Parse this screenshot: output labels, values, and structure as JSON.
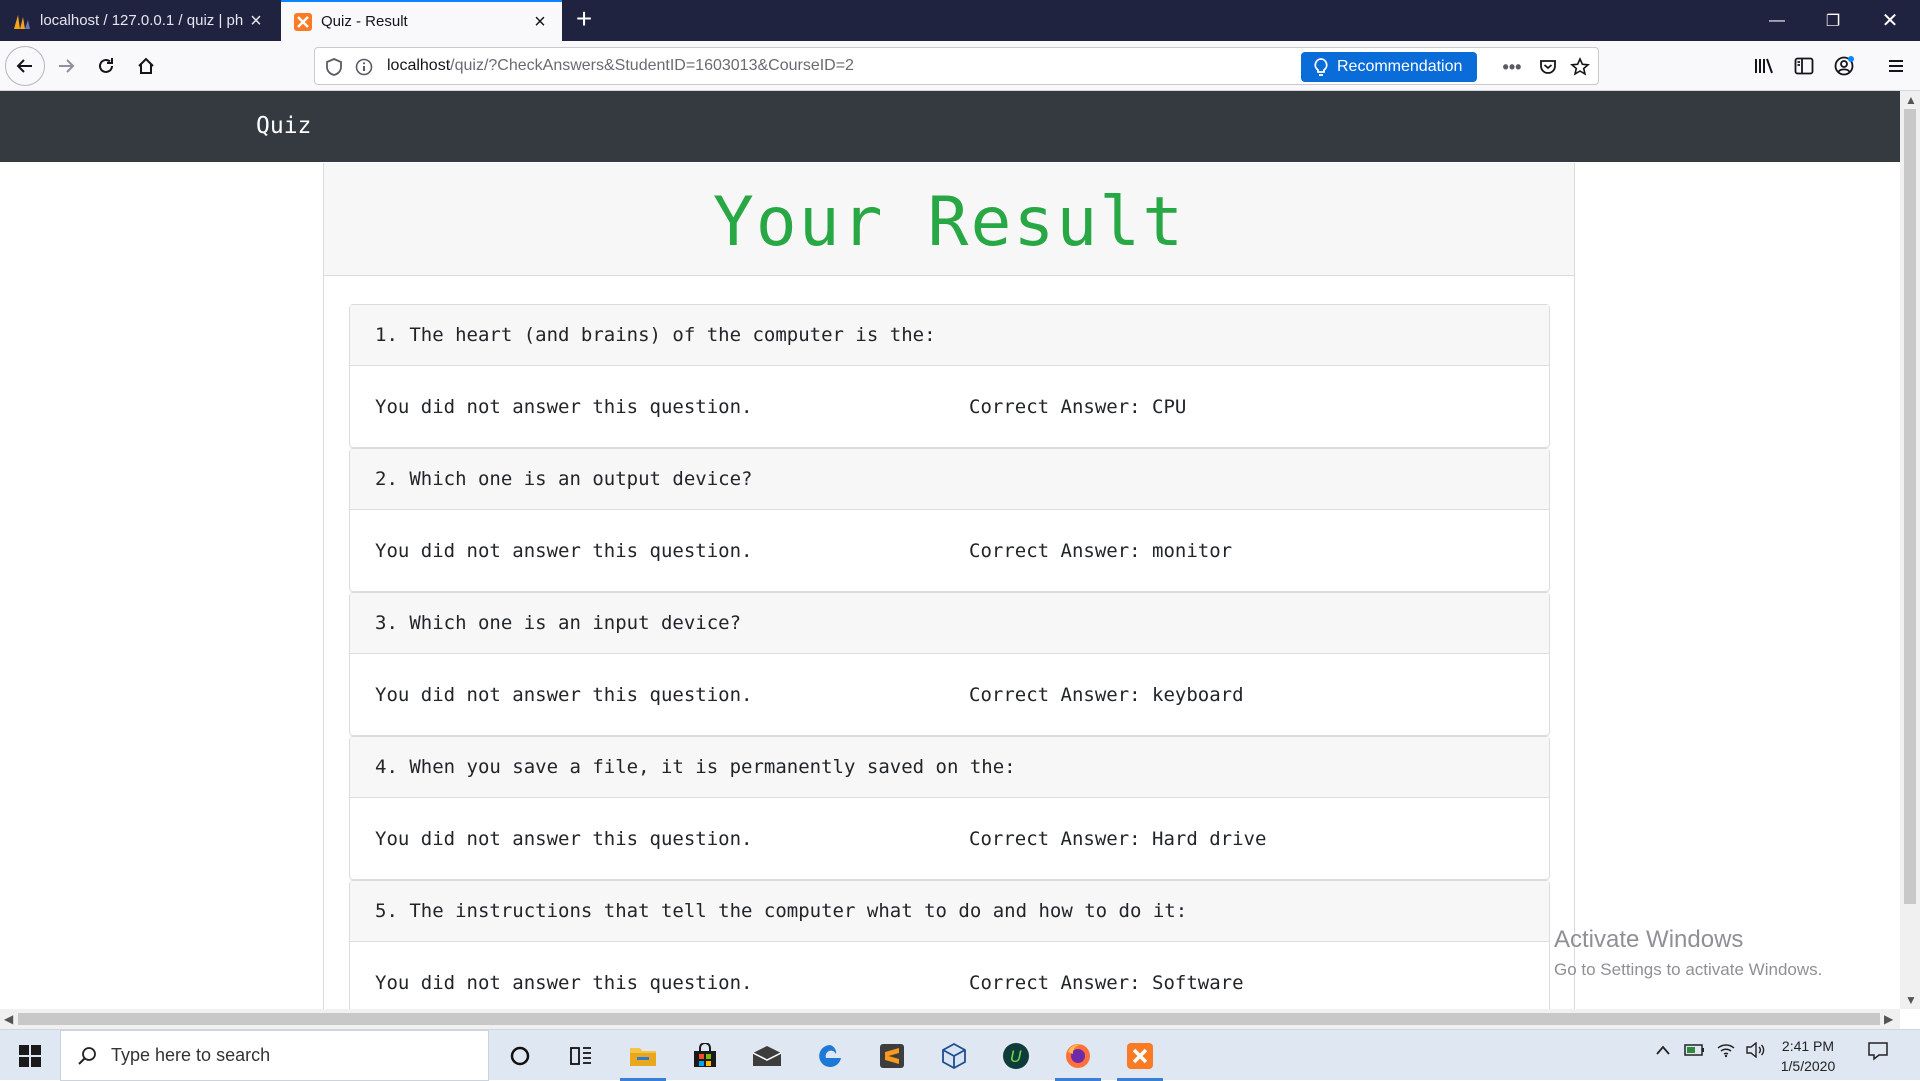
{
  "browser": {
    "tabs": [
      {
        "title": "localhost / 127.0.0.1 / quiz | ph",
        "active": false
      },
      {
        "title": "Quiz - Result",
        "active": true
      }
    ],
    "url": {
      "host": "localhost",
      "path": "/quiz/?CheckAnswers&StudentID=1603013&CourseID=2"
    },
    "recommendation_label": "Recommendation"
  },
  "site": {
    "brand": "Quiz",
    "result_title": "Your Result"
  },
  "questions": [
    {
      "question": "1. The heart (and brains) of the computer is the:",
      "status": "You did not answer this question.",
      "correct": "Correct Answer: CPU"
    },
    {
      "question": "2. Which one is an output device?",
      "status": "You did not answer this question.",
      "correct": "Correct Answer: monitor"
    },
    {
      "question": "3. Which one is an input device?",
      "status": "You did not answer this question.",
      "correct": "Correct Answer: keyboard"
    },
    {
      "question": "4. When you save a file, it is permanently saved on the:",
      "status": "You did not answer this question.",
      "correct": "Correct Answer: Hard drive"
    },
    {
      "question": "5. The instructions that tell the computer what to do and how to do it:",
      "status": "You did not answer this question.",
      "correct": "Correct Answer: Software"
    }
  ],
  "watermark": {
    "line1": "Activate Windows",
    "line2": "Go to Settings to activate Windows."
  },
  "taskbar": {
    "search_placeholder": "Type here to search",
    "time": "2:41 PM",
    "date": "1/5/2020"
  },
  "colors": {
    "result_green": "#28a745",
    "navbar_dark": "#343a40",
    "browser_dark": "#202340",
    "accent_blue": "#0a6cd8"
  }
}
